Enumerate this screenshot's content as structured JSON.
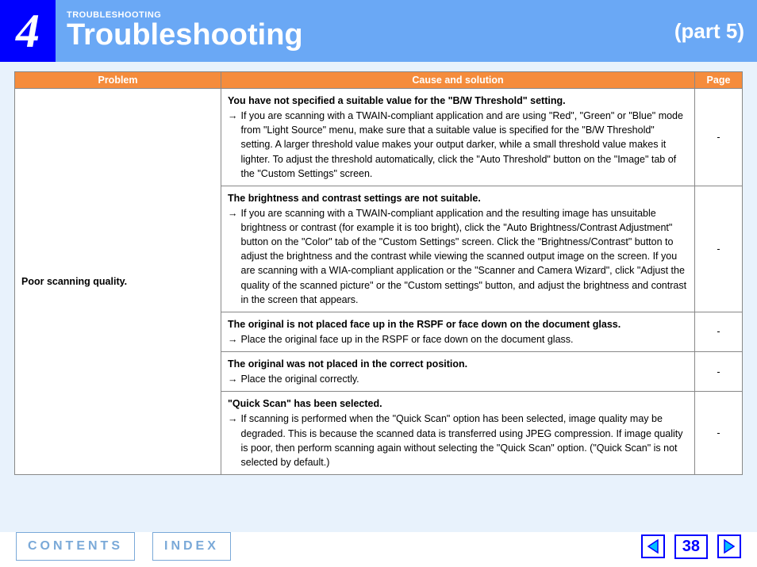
{
  "header": {
    "chapter_number": "4",
    "breadcrumb": "TROUBLESHOOTING",
    "title": "Troubleshooting",
    "part": "(part 5)"
  },
  "table": {
    "headers": {
      "problem": "Problem",
      "cause": "Cause and solution",
      "page": "Page"
    },
    "problem": "Poor scanning quality.",
    "rows": [
      {
        "bold": "You have not specified a suitable value for the \"B/W Threshold\" setting.",
        "body": "If you are scanning with a TWAIN-compliant application and are using \"Red\", \"Green\" or \"Blue\" mode from \"Light Source\" menu, make sure that a suitable value is specified for the \"B/W Threshold\" setting. A larger threshold value makes your output darker, while a small threshold value makes it lighter. To adjust the threshold automatically, click the \"Auto Threshold\" button on the \"Image\" tab of the \"Custom Settings\" screen.",
        "page": "-"
      },
      {
        "bold": "The brightness and contrast settings are not suitable.",
        "body": "If you are scanning with a TWAIN-compliant application and the resulting image has unsuitable brightness or contrast (for example it is too bright), click the \"Auto Brightness/Contrast Adjustment\" button on the \"Color\" tab of the \"Custom Settings\" screen. Click the \"Brightness/Contrast\" button to adjust the brightness and the contrast while viewing the scanned output image on the screen. If you are scanning with a WIA-compliant application or the \"Scanner and Camera Wizard\", click \"Adjust the quality of the scanned picture\" or the \"Custom settings\" button, and adjust the brightness and contrast in the screen that appears.",
        "page": "-"
      },
      {
        "bold": "The original is not placed face up in the RSPF or face down on the document glass.",
        "body": "Place the original face up in the RSPF or face down on the document glass.",
        "page": "-"
      },
      {
        "bold": "The original was not placed in the correct position.",
        "body": "Place the original correctly.",
        "page": "-"
      },
      {
        "bold": "\"Quick Scan\" has been selected.",
        "body": "If scanning is performed when the \"Quick Scan\" option has been selected, image quality may be degraded. This is because the scanned data is transferred using JPEG compression. If image quality is poor, then perform scanning again without selecting the \"Quick Scan\" option. (\"Quick Scan\" is not selected by default.)",
        "page": "-"
      }
    ]
  },
  "footer": {
    "contents": "CONTENTS",
    "index": "INDEX",
    "page_number": "38"
  }
}
